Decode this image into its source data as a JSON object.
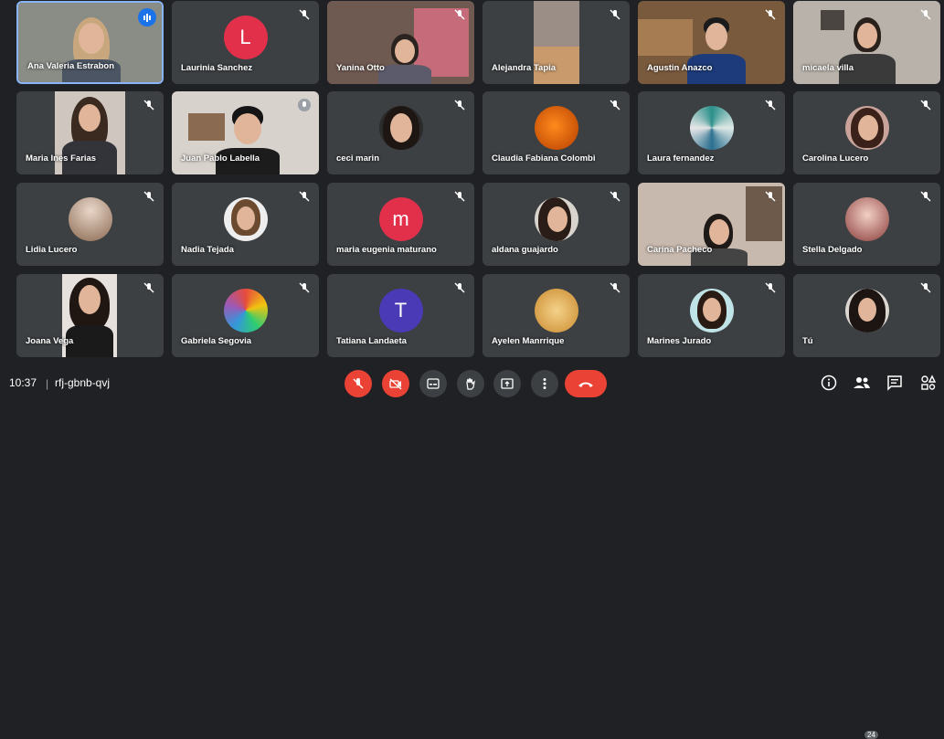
{
  "participants": [
    {
      "name": "Ana Valeria Estrabon"
    },
    {
      "name": "Laurinia Sanchez",
      "initial": "L",
      "color": "#e2304b"
    },
    {
      "name": "Yanina Otto"
    },
    {
      "name": "Alejandra Tapia"
    },
    {
      "name": "Agustin Anazco"
    },
    {
      "name": "micaela villa"
    },
    {
      "name": "Maria Ines Farias"
    },
    {
      "name": "Juan Pablo Labella"
    },
    {
      "name": "ceci marin"
    },
    {
      "name": "Claudia Fabiana Colombi"
    },
    {
      "name": "Laura fernandez"
    },
    {
      "name": "Carolina Lucero"
    },
    {
      "name": "Lidia Lucero"
    },
    {
      "name": "Nadia Tejada"
    },
    {
      "name": "maria eugenia maturano",
      "initial": "m",
      "color": "#e2304b"
    },
    {
      "name": "aldana guajardo"
    },
    {
      "name": "Carina Pacheco"
    },
    {
      "name": "Stella Delgado"
    },
    {
      "name": "Joana Vega"
    },
    {
      "name": "Gabriela Segovia"
    },
    {
      "name": "Tatiana Landaeta",
      "initial": "T",
      "color": "#4a3ab5"
    },
    {
      "name": "Ayelen Manrrique"
    },
    {
      "name": "Marines Jurado"
    },
    {
      "name": "Tú"
    }
  ],
  "meeting": {
    "time": "10:37",
    "separator": "|",
    "code": "rfj-gbnb-qvj"
  },
  "participant_count": "24",
  "icons": {
    "mic_off": "mic-off-icon",
    "camera_off": "camera-off-icon",
    "captions": "captions-icon",
    "hand": "raise-hand-icon",
    "present": "present-icon",
    "more": "more-options-icon",
    "hangup": "hangup-icon",
    "info": "info-icon",
    "people": "people-icon",
    "chat": "chat-icon",
    "activities": "activities-icon"
  },
  "colors": {
    "background": "#202124",
    "tile": "#3c4043",
    "end_call": "#ea4335",
    "active_border": "#8ab4f8"
  }
}
